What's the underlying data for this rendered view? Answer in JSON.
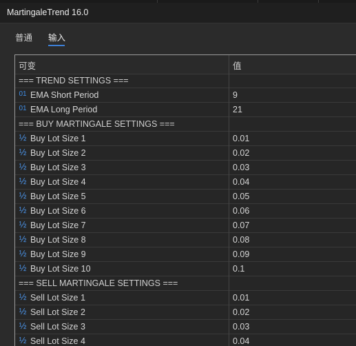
{
  "window": {
    "title": "MartingaleTrend 16.0"
  },
  "tabs": [
    {
      "label": "普通"
    },
    {
      "label": "输入",
      "active": true
    }
  ],
  "table": {
    "headers": {
      "variable": "可变",
      "value": "值"
    },
    "rows": [
      {
        "kind": "section",
        "label": "=== TREND SETTINGS ==="
      },
      {
        "kind": "int",
        "icon": "integer-icon",
        "label": "EMA Short Period",
        "value": "9"
      },
      {
        "kind": "int",
        "icon": "integer-icon",
        "label": "EMA Long Period",
        "value": "21"
      },
      {
        "kind": "section",
        "label": "=== BUY MARTINGALE SETTINGS ==="
      },
      {
        "kind": "double",
        "icon": "double-icon",
        "label": "Buy Lot Size 1",
        "value": "0.01"
      },
      {
        "kind": "double",
        "icon": "double-icon",
        "label": "Buy Lot Size 2",
        "value": "0.02"
      },
      {
        "kind": "double",
        "icon": "double-icon",
        "label": "Buy Lot Size 3",
        "value": "0.03"
      },
      {
        "kind": "double",
        "icon": "double-icon",
        "label": "Buy Lot Size 4",
        "value": "0.04"
      },
      {
        "kind": "double",
        "icon": "double-icon",
        "label": "Buy Lot Size 5",
        "value": "0.05"
      },
      {
        "kind": "double",
        "icon": "double-icon",
        "label": "Buy Lot Size 6",
        "value": "0.06"
      },
      {
        "kind": "double",
        "icon": "double-icon",
        "label": "Buy Lot Size 7",
        "value": "0.07"
      },
      {
        "kind": "double",
        "icon": "double-icon",
        "label": "Buy Lot Size 8",
        "value": "0.08"
      },
      {
        "kind": "double",
        "icon": "double-icon",
        "label": "Buy Lot Size 9",
        "value": "0.09"
      },
      {
        "kind": "double",
        "icon": "double-icon",
        "label": "Buy Lot Size 10",
        "value": "0.1"
      },
      {
        "kind": "section",
        "label": "=== SELL MARTINGALE SETTINGS ==="
      },
      {
        "kind": "double",
        "icon": "double-icon",
        "label": "Sell Lot Size 1",
        "value": "0.01"
      },
      {
        "kind": "double",
        "icon": "double-icon",
        "label": "Sell Lot Size 2",
        "value": "0.02"
      },
      {
        "kind": "double",
        "icon": "double-icon",
        "label": "Sell Lot Size 3",
        "value": "0.03"
      },
      {
        "kind": "double",
        "icon": "double-icon",
        "label": "Sell Lot Size 4",
        "value": "0.04"
      }
    ]
  },
  "icon_glyphs": {
    "integer-icon": "01",
    "double-icon": "½"
  },
  "colors": {
    "accent": "#3d7fd6",
    "icon": "#3f8ee8",
    "background": "#2b2b2b",
    "grid_border": "#9a9a9a"
  }
}
